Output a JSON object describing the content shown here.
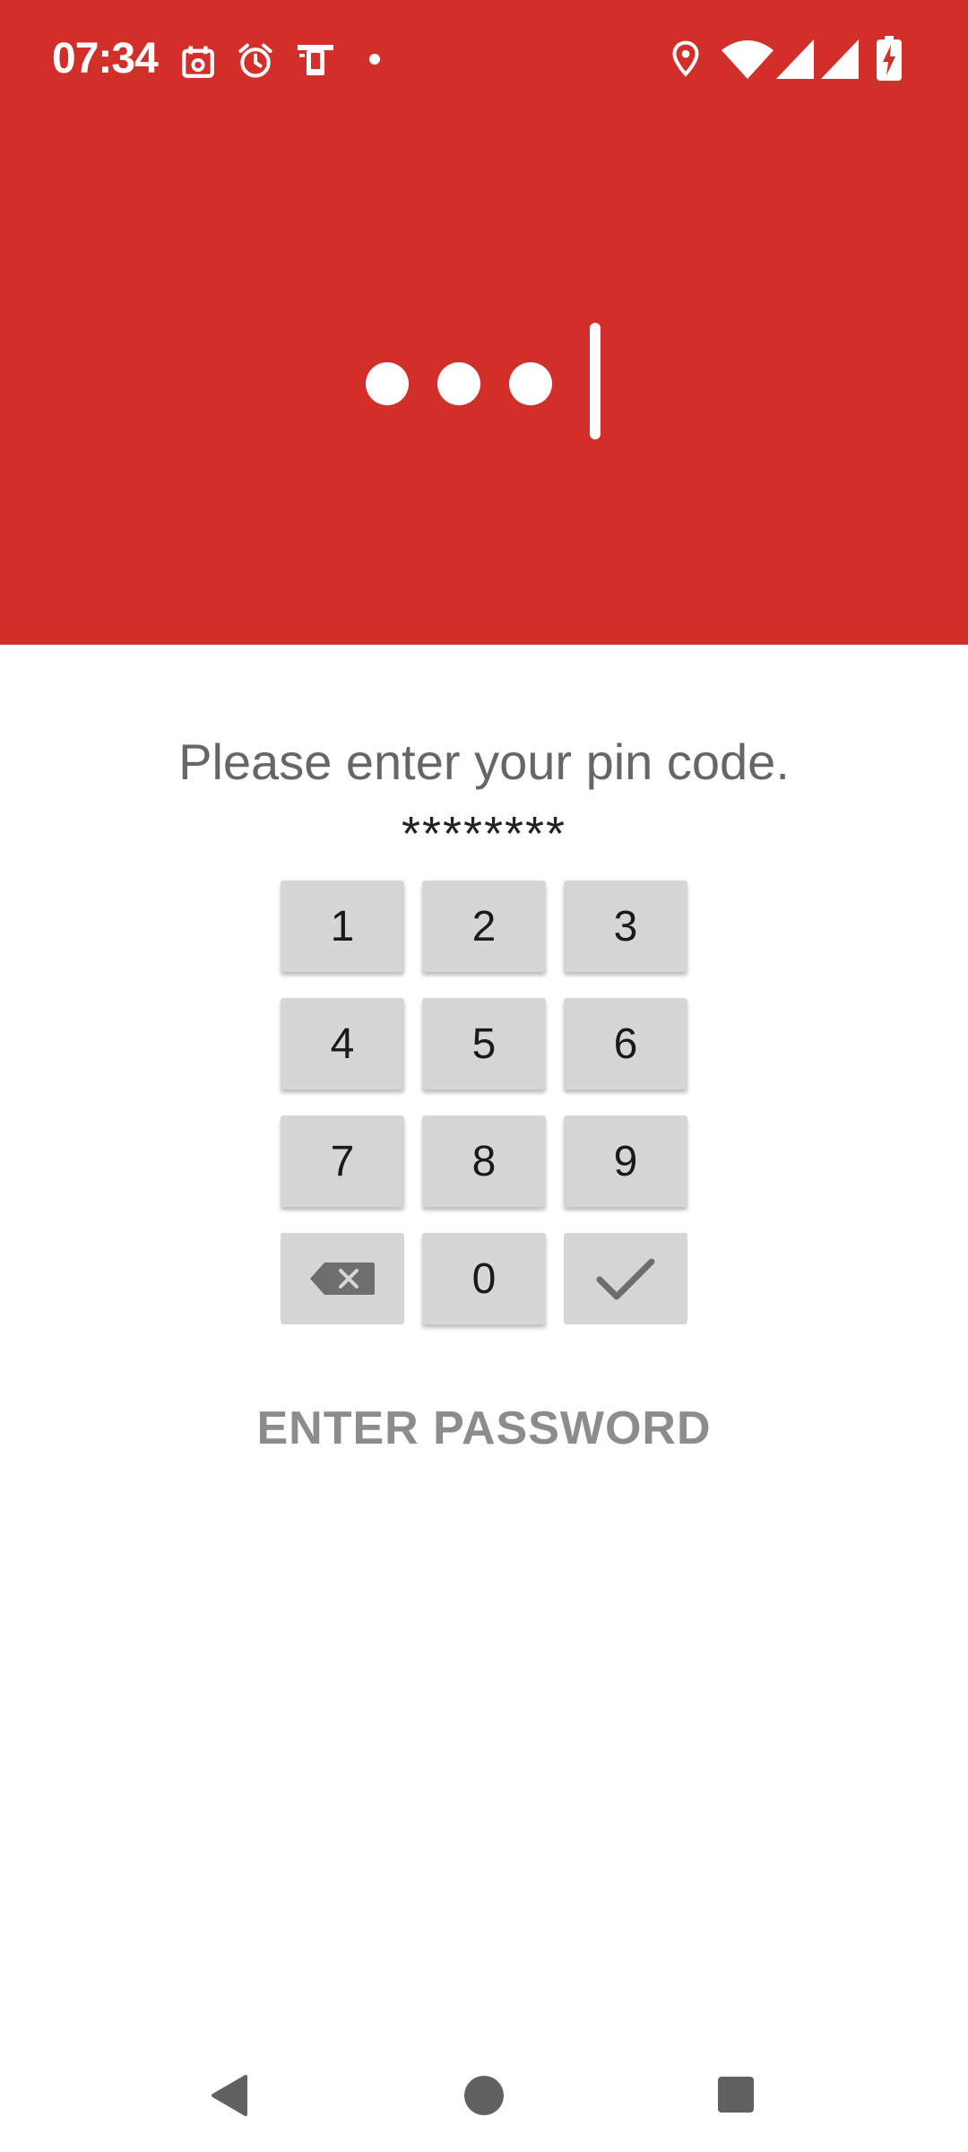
{
  "status_bar": {
    "time": "07:34",
    "left_icons": [
      "calendar-icon",
      "alarm-icon",
      "device-icon",
      "notification-dot"
    ],
    "right_icons": [
      "location-icon",
      "wifi-icon",
      "signal-icon",
      "signal-icon",
      "battery-charging-icon"
    ]
  },
  "colors": {
    "header": "#D32F2A",
    "key_background": "#D6D6D6",
    "prompt_text": "#666666",
    "link_text": "#8C8C8C"
  },
  "lock": {
    "prompt": "Please enter your pin code.",
    "pin_display": "********",
    "keys": [
      {
        "label": "1"
      },
      {
        "label": "2"
      },
      {
        "label": "3"
      },
      {
        "label": "4"
      },
      {
        "label": "5"
      },
      {
        "label": "6"
      },
      {
        "label": "7"
      },
      {
        "label": "8"
      },
      {
        "label": "9"
      },
      {
        "icon": "backspace-icon"
      },
      {
        "label": "0"
      },
      {
        "icon": "check-icon"
      }
    ],
    "enter_password_label": "ENTER PASSWORD"
  },
  "navigation": {
    "buttons": [
      "back-icon",
      "home-icon",
      "recents-icon"
    ]
  }
}
